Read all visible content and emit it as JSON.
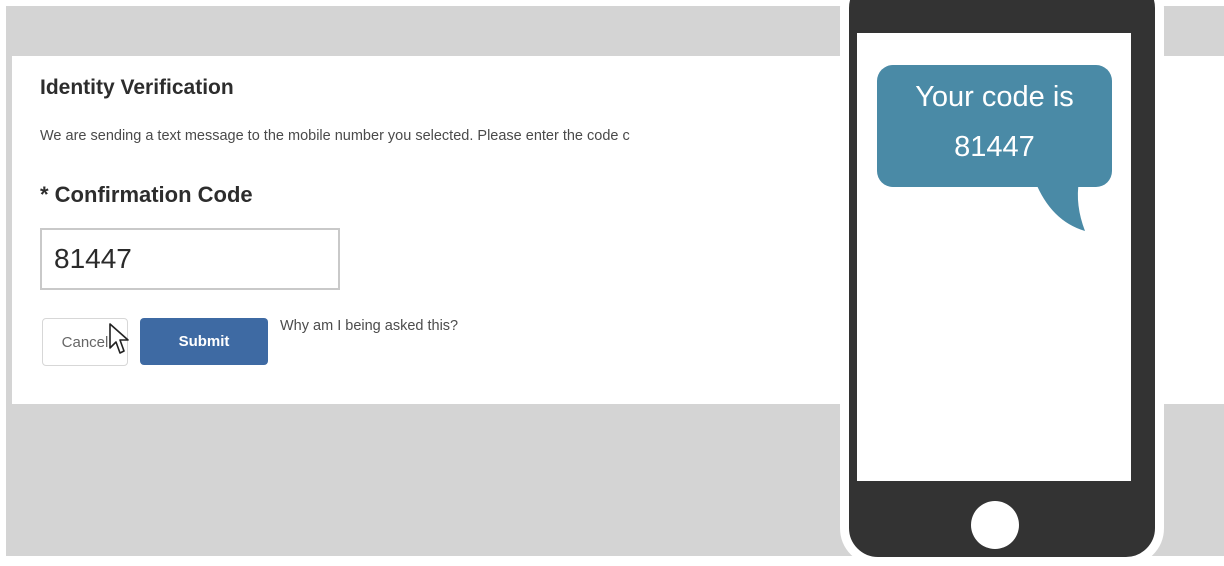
{
  "verification": {
    "title": "Identity Verification",
    "description": "We are sending a text message to the mobile number you selected. Please enter the code c",
    "code_label": "* Confirmation Code",
    "code_value": "81447",
    "cancel_label": "Cancel",
    "submit_label": "Submit",
    "help_link": "Why am I being asked this?"
  },
  "phone": {
    "message_line1": "Your code is",
    "message_line2": "81447"
  },
  "colors": {
    "submit_button": "#3e6aa3",
    "message_bubble": "#4a8aa6",
    "phone_body": "#333333",
    "page_background": "#d4d4d4"
  },
  "icons": {
    "pointer": "mouse-pointer-icon"
  }
}
